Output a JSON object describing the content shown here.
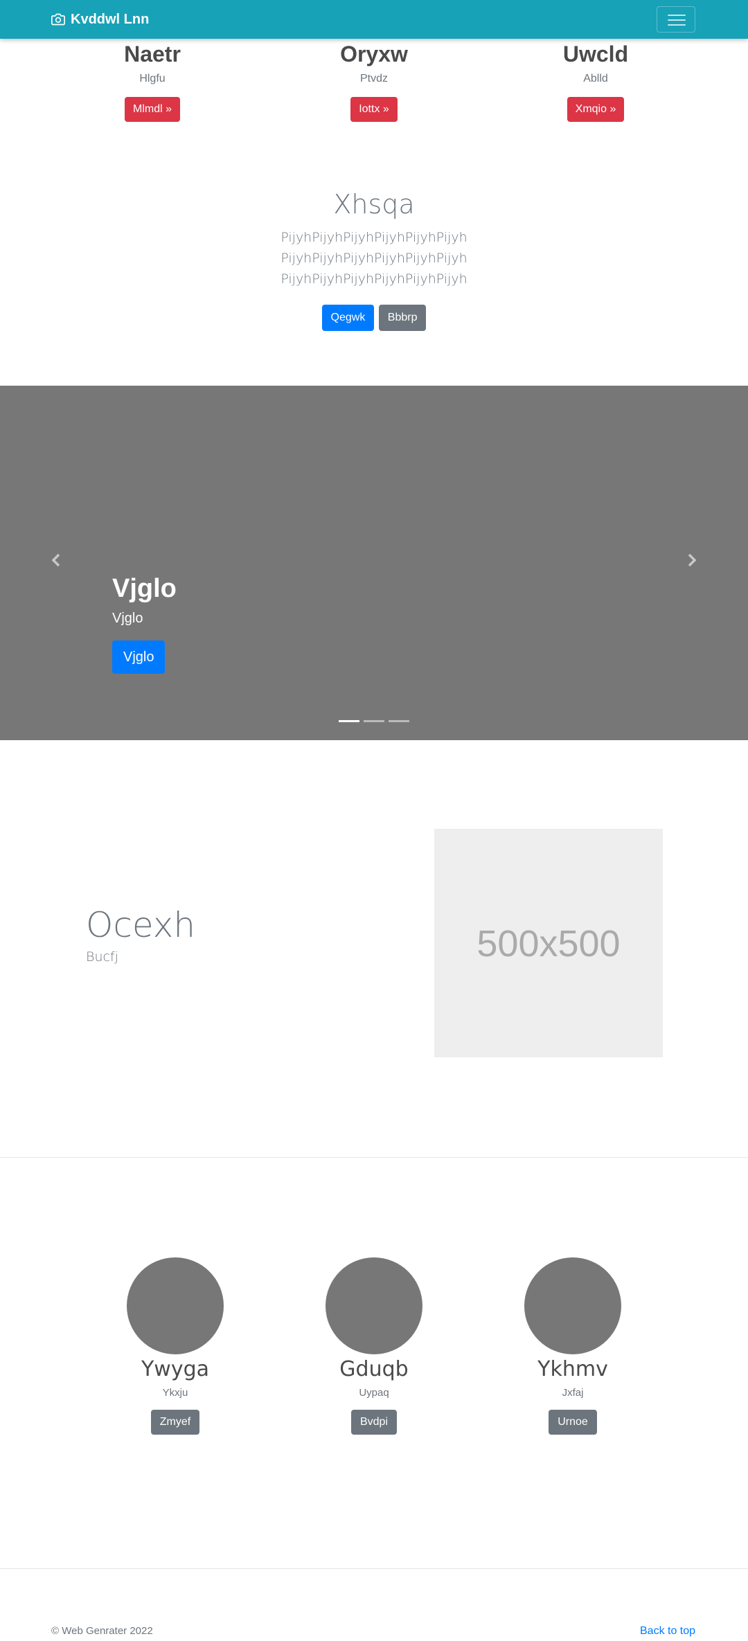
{
  "navbar": {
    "brand": "Kvddwl Lnn",
    "brand_icon": "camera-icon",
    "toggle_icon": "hamburger-icon"
  },
  "top_columns": [
    {
      "title": "Naetr",
      "subtitle": "Hlgfu",
      "button": "Mlmdl »"
    },
    {
      "title": "Oryxw",
      "subtitle": "Ptvdz",
      "button": "Iottx »"
    },
    {
      "title": "Uwcld",
      "subtitle": "Ablld",
      "button": "Xmqio »"
    }
  ],
  "jumbotron": {
    "title": "Xhsqa",
    "text": "PijyhPijyhPijyhPijyhPijyhPijyh PijyhPijyhPijyhPijyhPijyhPijyh PijyhPijyhPijyhPijyhPijyhPijyh",
    "primary_button": "Qegwk",
    "secondary_button": "Bbbrp"
  },
  "carousel": {
    "title": "Vjglo",
    "subtitle": "Vjglo",
    "button": "Vjglo",
    "slide_count": 3,
    "active_slide": 1
  },
  "feature": {
    "title": "Ocexh",
    "subtitle": "Bucfj",
    "placeholder": "500x500"
  },
  "team": [
    {
      "name": "Ywyga",
      "role": "Ykxju",
      "button": "Zmyef"
    },
    {
      "name": "Gduqb",
      "role": "Uypaq",
      "button": "Bvdpi"
    },
    {
      "name": "Ykhmv",
      "role": "Jxfaj",
      "button": "Urnoe"
    }
  ],
  "footer": {
    "copyright": "© Web Genrater 2022",
    "back_to_top": "Back to top"
  },
  "colors": {
    "navbar": "#17a2b8",
    "danger": "#dc3545",
    "primary": "#007bff",
    "secondary": "#6c757d",
    "carousel_bg": "#777777"
  }
}
